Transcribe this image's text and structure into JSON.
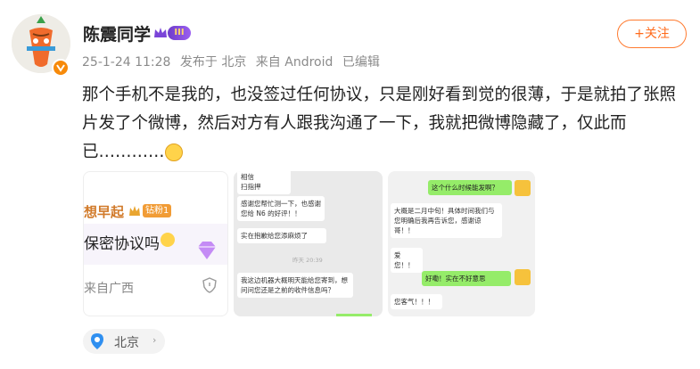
{
  "header": {
    "username": "陈震同学",
    "level_badge": "III",
    "follow_label": "+关注",
    "date": "25-1-24 11:28",
    "posted_in": "发布于 北京",
    "source": "来自 Android",
    "edited": "已编辑"
  },
  "post": {
    "line1": "那个手机不是我的，也没签过任何协议，只是刚好看到觉的很薄，于是就拍了张照",
    "line2": "片发了个微博，然后对方有人跟我沟通了一下，我就把微博隐藏了，仅此而",
    "line3": "已…………"
  },
  "image1": {
    "name_fragment": "想早起",
    "badge": "钻粉1",
    "comment": "保密协议吗",
    "location": "来自广西"
  },
  "image2": {
    "top_text": "相信",
    "top_text2": "扫指押",
    "bubble1": "感谢您帮忙测一下，也感谢您给 N6 的好评！！",
    "bubble2": "实在抱歉给您添麻烦了",
    "timestamp": "昨天 20:39",
    "bubble3": "我这边机器大概明天能给您寄到，想问问您还是之前的收件信息吗？"
  },
  "image3": {
    "bubble1": "这个什么时候能发啊？",
    "bubble2": "大概是二月中旬！具体时间我们与您明确后我再告诉您，感谢谅哥！！",
    "bubble3": "爱您！！",
    "bubble4": "好嘞！实在不好意思",
    "bubble5": "您客气！！！"
  },
  "location": {
    "label": "北京",
    "icon": "map-pin-icon"
  },
  "colors": {
    "accent_orange": "#ff6a1a",
    "wechat_green": "#95ec69",
    "vip_purple": "#7a44d8"
  }
}
